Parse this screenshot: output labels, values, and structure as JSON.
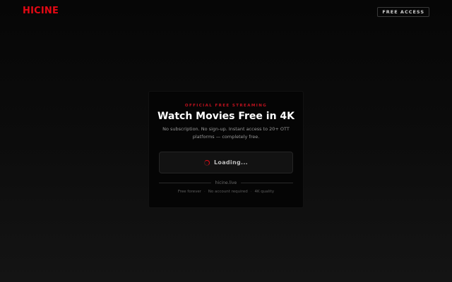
{
  "header": {
    "logo": "HICINE",
    "cta_label": "FREE ACCESS"
  },
  "card": {
    "eyebrow": "OFFICIAL FREE STREAMING",
    "title": "Watch Movies Free in 4K",
    "subtitle": "No subscription. No sign-up. Instant access to 20+ OTT platforms — completely free.",
    "loading_label": "Loading...",
    "site_name": "hicine.live",
    "features": [
      "Free forever",
      "No account required",
      "4K quality"
    ]
  },
  "colors": {
    "brand": "#e50914",
    "background": "#0a0a0a",
    "card": "#050505"
  }
}
